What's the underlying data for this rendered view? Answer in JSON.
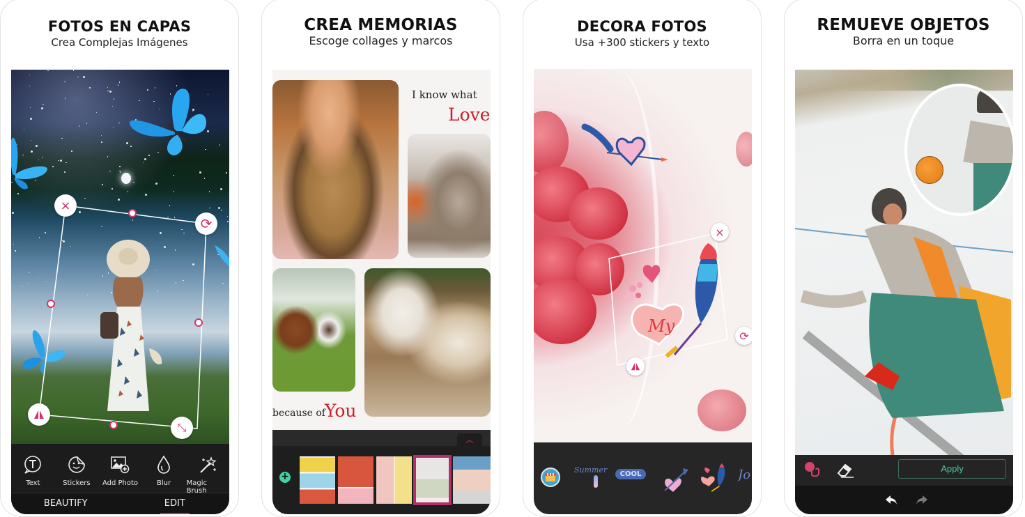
{
  "cards": [
    {
      "title": "FOTOS EN CAPAS",
      "subtitle": "Crea Complejas Imágenes",
      "tools": [
        {
          "label": "Text",
          "icon": "text-bubble-icon"
        },
        {
          "label": "Stickers",
          "icon": "sticker-smiley-icon"
        },
        {
          "label": "Add Photo",
          "icon": "add-photo-icon"
        },
        {
          "label": "Blur",
          "icon": "blur-drop-icon"
        },
        {
          "label": "Magic Brush",
          "icon": "magic-wand-icon"
        }
      ],
      "tabs": [
        {
          "label": "BEAUTIFY",
          "active": false
        },
        {
          "label": "EDIT",
          "active": true
        }
      ],
      "handles": {
        "close": "×",
        "rotate": "⟳",
        "flip": "flip-icon",
        "resize": "⤡"
      }
    },
    {
      "title": "CREA MEMORIAS",
      "subtitle": "Escoge collages y marcos",
      "collage_text": {
        "line1": "I know what",
        "love": "Love",
        "because": "because of",
        "you": "You"
      },
      "add_label": "+",
      "chevron": "︿"
    },
    {
      "title": "DECORA FOTOS",
      "subtitle": "Usa +300 stickers y texto",
      "sticker_text": "My",
      "stickers": [
        "store-icon",
        "summer-sticker",
        "cool-sticker",
        "heart-arrow-sticker",
        "my-feather-sticker",
        "joy-sticker"
      ],
      "sticker_labels": {
        "summer": "Summer",
        "cool": "COOL",
        "joy": "Jo"
      }
    },
    {
      "title": "REMUEVE OBJETOS",
      "subtitle": "Borra en un toque",
      "apply_label": "Apply",
      "tools": [
        "restore-brush-icon",
        "eraser-icon"
      ],
      "nav": [
        "undo-icon",
        "redo-icon"
      ]
    }
  ],
  "colors": {
    "accent_pink": "#c2306a",
    "apply_green": "#4ec69a",
    "add_green": "#3fd3a0",
    "toolbar_dark": "#1c1c1c",
    "love_red": "#c8202c"
  }
}
